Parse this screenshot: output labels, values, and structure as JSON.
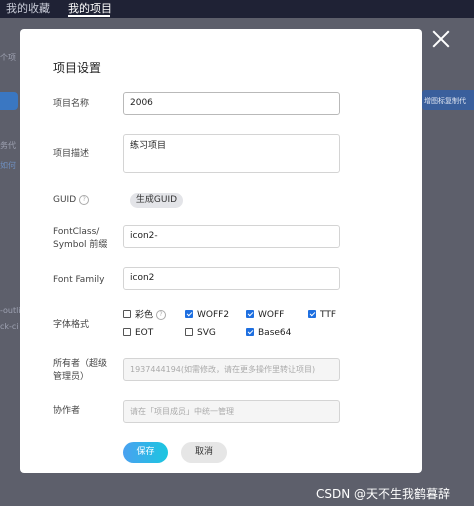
{
  "background": {
    "tabs": [
      "我的收藏",
      "我的项目"
    ],
    "fragments": {
      "left1": "个项",
      "left2": "务代",
      "left3": "如何",
      "left4": "-outli",
      "left5": "ck-ci",
      "right1": "增图标复制代"
    }
  },
  "modal": {
    "title": "项目设置",
    "name": {
      "label": "项目名称",
      "value": "2006"
    },
    "description": {
      "label": "项目描述",
      "value": "练习项目"
    },
    "guid": {
      "label": "GUID",
      "button": "生成GUID"
    },
    "prefix": {
      "label_line1": "FontClass/",
      "label_line2": "Symbol 前缀",
      "value": "icon2-"
    },
    "font_family": {
      "label": "Font Family",
      "value": "icon2"
    },
    "font_format": {
      "label": "字体格式",
      "options": [
        {
          "label": "彩色",
          "checked": false,
          "help": true
        },
        {
          "label": "WOFF2",
          "checked": true
        },
        {
          "label": "WOFF",
          "checked": true
        },
        {
          "label": "TTF",
          "checked": true
        },
        {
          "label": "EOT",
          "checked": false
        },
        {
          "label": "SVG",
          "checked": false
        },
        {
          "label": "Base64",
          "checked": true
        }
      ]
    },
    "owner": {
      "label_line1": "所有者（超级",
      "label_line2": "管理员）",
      "value": "1937444194(如需修改，请在更多操作里转让项目)"
    },
    "collaborator": {
      "label": "协作者",
      "placeholder": "请在「项目成员」中统一管理"
    },
    "save_label": "保存",
    "cancel_label": "取消",
    "help_glyph": "?"
  },
  "watermark": "CSDN @天不生我鹤暮辞",
  "colors": {
    "primary": "#1e6fe0",
    "save_gradient_start": "#4aa1f0",
    "save_gradient_end": "#1bc6e0"
  }
}
